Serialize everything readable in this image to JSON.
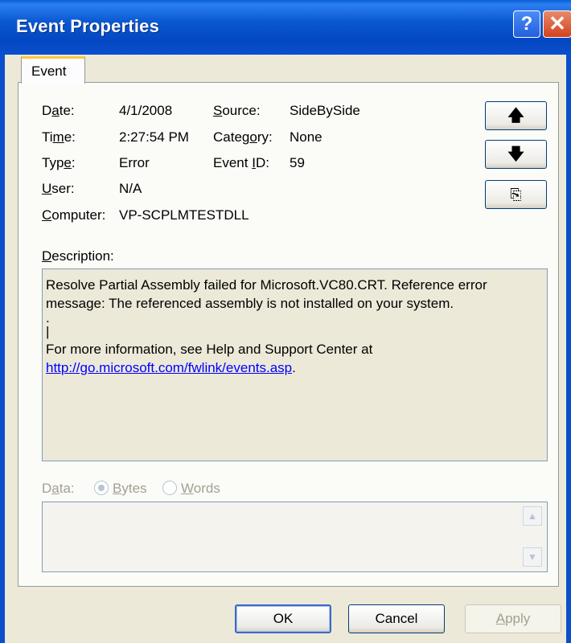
{
  "window": {
    "title": "Event Properties",
    "help_glyph": "?",
    "close_glyph": "✕"
  },
  "tabs": [
    {
      "label": "Event",
      "active": true
    }
  ],
  "fields": {
    "date": {
      "label_pre": "D",
      "label_ul": "a",
      "label_post": "te:",
      "value": "4/1/2008"
    },
    "time": {
      "label_pre": "Ti",
      "label_ul": "m",
      "label_post": "e:",
      "value": "2:27:54 PM"
    },
    "type": {
      "label_pre": "Typ",
      "label_ul": "e",
      "label_post": ":",
      "value": "Error"
    },
    "user": {
      "label_pre": "",
      "label_ul": "U",
      "label_post": "ser:",
      "value": "N/A"
    },
    "computer": {
      "label_pre": "",
      "label_ul": "C",
      "label_post": "omputer:",
      "value": "VP-SCPLMTESTDLL"
    },
    "source": {
      "label_pre": "",
      "label_ul": "S",
      "label_post": "ource:",
      "value": "SideBySide"
    },
    "category": {
      "label_pre": "Categ",
      "label_ul": "o",
      "label_post": "ry:",
      "value": "None"
    },
    "event_id": {
      "label_pre": "Event ",
      "label_ul": "I",
      "label_post": "D:",
      "value": "59"
    }
  },
  "nav": {
    "up_glyph": "🡅",
    "down_glyph": "🡇",
    "copy_glyph": "⎘"
  },
  "description": {
    "label_ul": "D",
    "label_post": "escription:",
    "lines": [
      "Resolve Partial Assembly failed for Microsoft.VC80.CRT. Reference error",
      "message: The referenced assembly is not installed on your system.",
      ".",
      "|",
      "For more information, see Help and Support Center at"
    ],
    "link": "http://go.microsoft.com/fwlink/events.asp",
    "link_suffix": "."
  },
  "data": {
    "label_pre": "D",
    "label_ul": "a",
    "label_post": "ta:",
    "bytes": {
      "ul": "B",
      "rest": "ytes",
      "selected": true
    },
    "words": {
      "ul": "W",
      "rest": "ords",
      "selected": false
    }
  },
  "buttons": {
    "ok": "OK",
    "cancel": "Cancel",
    "apply_ul": "A",
    "apply_rest": "pply"
  }
}
